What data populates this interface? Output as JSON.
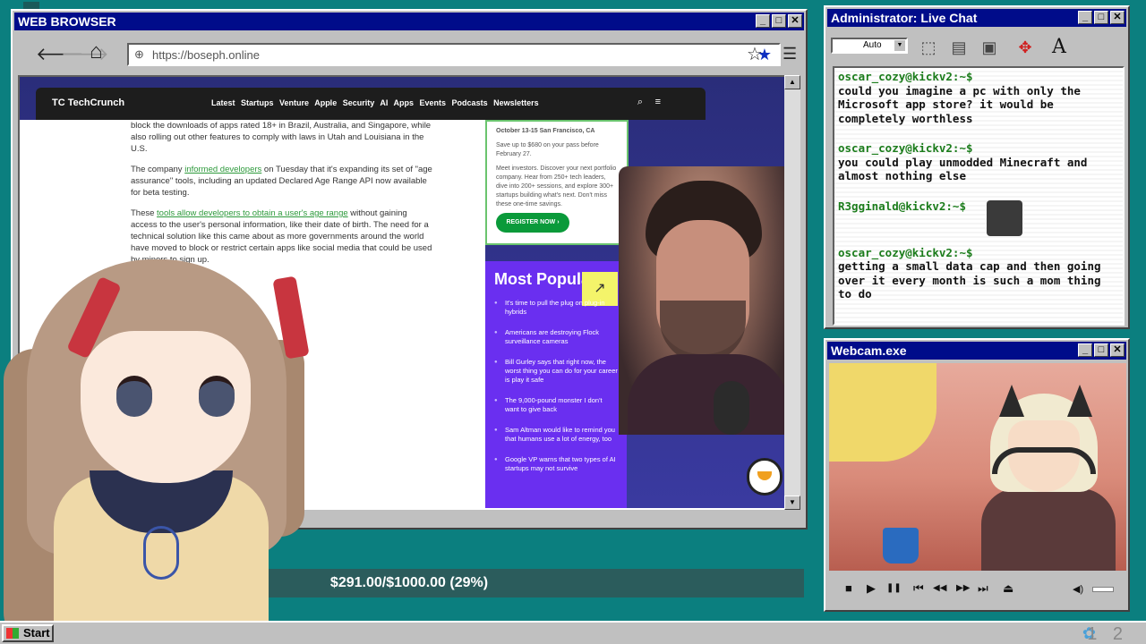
{
  "browser": {
    "title": "WEB BROWSER",
    "url": "https://boseph.online",
    "nav": {
      "back": "🡐",
      "forward": "🡒",
      "home": "⌂",
      "star_filled": "★",
      "star_empty": "☆",
      "menu": "☰"
    }
  },
  "techcrunch": {
    "logo": "TC TechCrunch",
    "links": "Latest Startups Venture Apple Security AI Apps Events Podcasts Newsletters",
    "paragraphs": [
      {
        "pre": "block the downloads of apps rated 18+ in Brazil, Australia, and Singapore, while also rolling out other features to comply with laws in Utah and Louisiana in the U.S."
      },
      {
        "pre": "The company ",
        "link": "informed developers",
        "post": " on Tuesday that it's expanding its set of \"age assurance\" tools, including an updated Declared Age Range API now available for beta testing."
      },
      {
        "pre": "These ",
        "link": "tools allow developers to obtain a user's age range",
        "post": " without gaining access to the user's personal information, like their date of birth. The need for a technical solution like this came about as more governments around the world have moved to block or restrict certain apps like social media that could be used by minors to sign up."
      }
    ],
    "event": {
      "line1": "October 13-15    San Francisco, CA",
      "line2": "Save up to $680 on your pass before February 27.",
      "line3": "Meet investors. Discover your next portfolio company. Hear from 250+ tech leaders, dive into 200+ sessions, and explore 300+ startups building what's next. Don't miss these one-time savings.",
      "register": "REGISTER NOW ›"
    },
    "popular": {
      "title": "Most Popular",
      "trend_icon": "↗",
      "items": [
        "It's time to pull the plug on plug-in hybrids",
        "Americans are destroying Flock surveillance cameras",
        "Bill Gurley says that right now, the worst thing you can do for your career is play it safe",
        "The 9,000-pound monster I don't want to give back",
        "Sam Altman would like to remind you that humans use a lot of energy, too",
        "Google VP warns that two types of AI startups may not survive"
      ]
    }
  },
  "chat": {
    "title": "Administrator: Live Chat",
    "font_select": "Auto",
    "tools": [
      "⬚",
      "▤",
      "▣",
      "✥",
      "A"
    ],
    "messages": [
      {
        "user": "oscar_cozy@kickv2:~$",
        "text": "could you imagine a pc with only the Microsoft app store? it would be completely worthless"
      },
      {
        "user": "oscar_cozy@kickv2:~$",
        "text": "you could play unmodded Minecraft and almost nothing else"
      },
      {
        "user": "R3gginald@kickv2:~$",
        "text": ""
      },
      {
        "user": "oscar_cozy@kickv2:~$",
        "text": "getting a small data cap and then going over it every month is such a mom thing to do"
      }
    ]
  },
  "webcam": {
    "title": "Webcam.exe",
    "controls": [
      "■",
      "▶",
      "❚❚",
      "⏮",
      "◀◀",
      "▶▶",
      "⏭",
      "⏏",
      "◀)"
    ]
  },
  "goal": {
    "text": "$291.00/$1000.00 (29%)",
    "progress": 0.291
  },
  "taskbar": {
    "start": "Start",
    "clock": "1 2"
  },
  "colors": {
    "desktop": "#0b7f7f",
    "titlebar": "#000c8a",
    "chat_user": "#1b7c1b",
    "popular_bg": "#6a2ff0"
  }
}
